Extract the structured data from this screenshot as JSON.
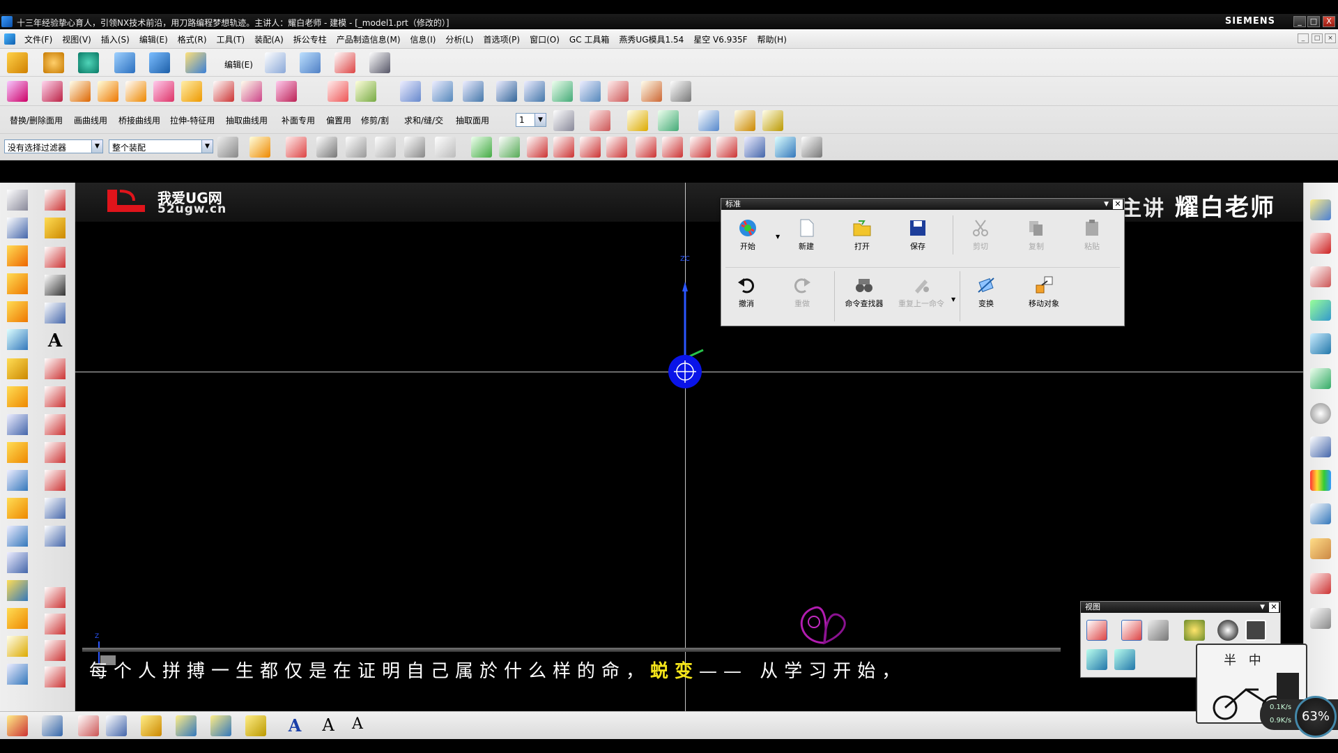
{
  "window": {
    "title": "十三年经验挚心育人，引领NX技术前沿，用刀路编程梦想轨迹。主讲人：耀白老师 - 建模 - [_model1.prt（修改的）]",
    "brand": "SIEMENS",
    "controls": [
      "_",
      "□",
      "X"
    ]
  },
  "menubar": {
    "items": [
      "文件(F)",
      "视图(V)",
      "插入(S)",
      "编辑(E)",
      "格式(R)",
      "工具(T)",
      "装配(A)",
      "拆公专柱",
      "产品制造信息(M)",
      "信息(I)",
      "分析(L)",
      "首选项(P)",
      "窗口(O)",
      "GC 工具箱",
      "燕秀UG模具1.54",
      "星空 V6.935F",
      "帮助(H)"
    ]
  },
  "toolbars": {
    "edit_label": "编辑(E)",
    "row3_labels": [
      "替换/删除面用",
      "画曲线用",
      "桥接曲线用",
      "拉伸-特征用",
      "抽取曲线用",
      "补面专用",
      "偏置用",
      "修剪/割",
      "求和/缝/交",
      "抽取面用"
    ],
    "layer_value": "1",
    "filter_value": "没有选择过滤器",
    "scope_value": "整个装配"
  },
  "canvas": {
    "logo_line1": "我爱UG网",
    "logo_line2": "52ugw.cn",
    "teacher": "耀白老师",
    "teacher_prefix": "主讲",
    "axis_label_top": "ZC",
    "axis_label_small": "Z",
    "caption_pre": "每个人拼搏一生都仅是在证明自己属於什么样的命，",
    "caption_highlight": "蜕变",
    "caption_post": "—— 从学习开始，"
  },
  "standard_dialog": {
    "title": "标准",
    "row1": [
      {
        "label": "开始",
        "icon": "start-icon",
        "enabled": true
      },
      {
        "label": "新建",
        "icon": "new-file-icon",
        "enabled": true
      },
      {
        "label": "打开",
        "icon": "open-folder-icon",
        "enabled": true
      },
      {
        "label": "保存",
        "icon": "save-icon",
        "enabled": true
      },
      {
        "label": "剪切",
        "icon": "scissors-icon",
        "enabled": false
      },
      {
        "label": "复制",
        "icon": "copy-icon",
        "enabled": false
      },
      {
        "label": "粘贴",
        "icon": "paste-icon",
        "enabled": false
      }
    ],
    "row2": [
      {
        "label": "撤消",
        "icon": "undo-icon",
        "enabled": true
      },
      {
        "label": "重做",
        "icon": "redo-icon",
        "enabled": false
      },
      {
        "label": "命令查找器",
        "icon": "binoculars-icon",
        "enabled": true
      },
      {
        "label": "重复上一命令",
        "icon": "repeat-icon",
        "enabled": false
      },
      {
        "label": "变换",
        "icon": "transform-icon",
        "enabled": true
      },
      {
        "label": "移动对象",
        "icon": "move-object-icon",
        "enabled": true
      }
    ]
  },
  "view_dialog": {
    "title": "视图"
  },
  "overlay": {
    "chars": "半 中",
    "net_up": "0.1K/s",
    "net_down": "0.9K/s",
    "gauge": "63%"
  },
  "colors": {
    "background": "#000000",
    "caption_highlight": "#f5e51a",
    "origin_marker": "#0a14e8"
  }
}
